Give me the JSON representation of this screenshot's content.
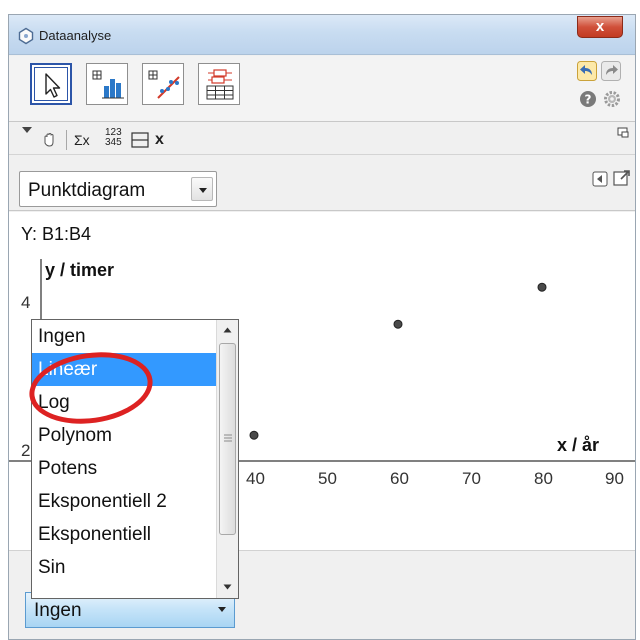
{
  "window": {
    "title": "Dataanalyse",
    "close_label": "x"
  },
  "toolbar": {
    "tools": [
      "move-tool",
      "one-variable-analysis",
      "two-variable-regression",
      "multi-variable-analysis"
    ],
    "active_tool": "move-tool"
  },
  "subbar": {
    "sigma_label": "Σx",
    "num_top": "123",
    "num_bottom": "345",
    "x_label": "x"
  },
  "plot_type": {
    "selected": "Punktdiagram"
  },
  "plot": {
    "y_range_label": "Y:  B1:B4",
    "y_axis_label": "y / timer",
    "x_axis_label": "x / år",
    "y_ticks": [
      "4",
      "2"
    ],
    "x_ticks": [
      "40",
      "50",
      "60",
      "70",
      "80",
      "90"
    ]
  },
  "chart_data": {
    "type": "scatter",
    "points": [
      {
        "x": 40,
        "y": 2.2
      },
      {
        "x": 60,
        "y": 3.7
      },
      {
        "x": 80,
        "y": 4.2
      }
    ],
    "xlabel": "x / år",
    "ylabel": "y / timer",
    "grid": false
  },
  "regression_dropdown": {
    "options": [
      "Ingen",
      "Lineær",
      "Log",
      "Polynom",
      "Potens",
      "Eksponentiell 2",
      "Eksponentiell",
      "Sin"
    ],
    "highlighted": "Lineær"
  },
  "regression_combo": {
    "selected": "Ingen"
  },
  "colors": {
    "selection_blue": "#3399ff",
    "annotation_red": "#dd2222",
    "active_tool_border": "#2c55a8"
  }
}
